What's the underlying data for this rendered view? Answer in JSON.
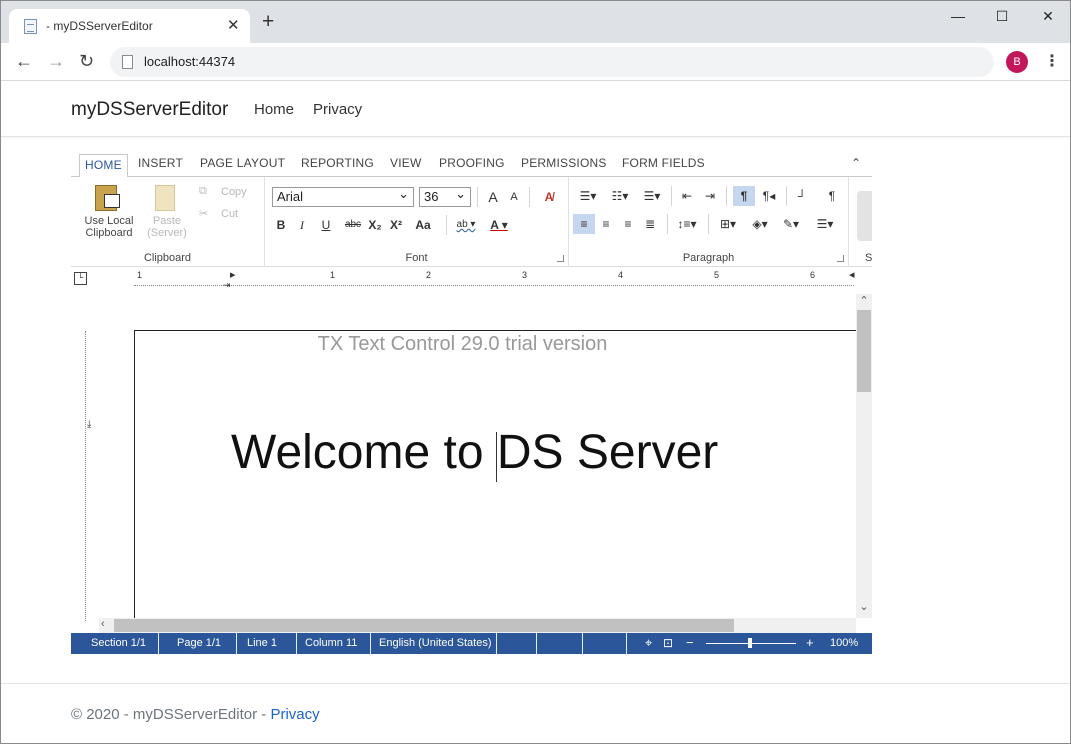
{
  "browser": {
    "tab_title": "- myDSServerEditor",
    "tab_close": "✕",
    "new_tab": "+",
    "url": "localhost:44374",
    "avatar_letter": "B",
    "accent_avatar": "#c2185b"
  },
  "site": {
    "brand": "myDSServerEditor",
    "nav": [
      "Home",
      "Privacy"
    ]
  },
  "ribbon": {
    "tabs": [
      "HOME",
      "INSERT",
      "PAGE LAYOUT",
      "REPORTING",
      "VIEW",
      "PROOFING",
      "PERMISSIONS",
      "FORM FIELDS"
    ],
    "active_tab": "HOME",
    "clipboard": {
      "group_label": "Clipboard",
      "use_local_line1": "Use Local",
      "use_local_line2": "Clipboard",
      "paste_line1": "Paste",
      "paste_line2": "(Server)",
      "copy": "Copy",
      "cut": "Cut"
    },
    "font": {
      "group_label": "Font",
      "family": "Arial",
      "size": "36",
      "bold": "B",
      "italic": "I",
      "underline": "U",
      "strike": "abc",
      "subscript": "X₂",
      "superscript": "X²",
      "case": "Aa",
      "grow": "A",
      "shrink": "A"
    },
    "paragraph": {
      "group_label": "Paragraph",
      "pilcrow": "¶"
    },
    "styles_label": "S"
  },
  "ruler": {
    "numbers": [
      "1",
      "1",
      "2",
      "3",
      "4",
      "5",
      "6"
    ]
  },
  "document": {
    "watermark": "TX Text Control 29.0 trial version",
    "text": "Welcome to DS Server"
  },
  "statusbar": {
    "section": "Section 1/1",
    "page": "Page 1/1",
    "line": "Line 1",
    "column": "Column 11",
    "language": "English (United States)",
    "zoom_minus": "−",
    "zoom_plus": "+",
    "zoom": "100%",
    "bar_color": "#2b579a"
  },
  "footer": {
    "copyright": "© 2020 - myDSServerEditor - ",
    "privacy": "Privacy"
  }
}
